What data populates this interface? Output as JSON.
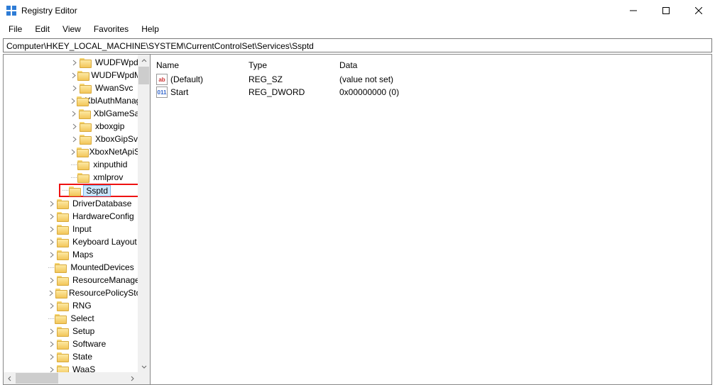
{
  "window": {
    "title": "Registry Editor"
  },
  "menu": {
    "file": "File",
    "edit": "Edit",
    "view": "View",
    "favorites": "Favorites",
    "help": "Help"
  },
  "address": "Computer\\HKEY_LOCAL_MACHINE\\SYSTEM\\CurrentControlSet\\Services\\Ssptd",
  "tree": {
    "deep": [
      {
        "label": "WUDFWpdFs",
        "expandable": true,
        "indent": 94
      },
      {
        "label": "WUDFWpdMtp",
        "expandable": true,
        "indent": 94
      },
      {
        "label": "WwanSvc",
        "expandable": true,
        "indent": 94
      },
      {
        "label": "XblAuthManager",
        "expandable": true,
        "indent": 94
      },
      {
        "label": "XblGameSave",
        "expandable": true,
        "indent": 94
      },
      {
        "label": "xboxgip",
        "expandable": true,
        "indent": 94
      },
      {
        "label": "XboxGipSvc",
        "expandable": true,
        "indent": 94
      },
      {
        "label": "XboxNetApiSvc",
        "expandable": true,
        "indent": 94
      },
      {
        "label": "xinputhid",
        "expandable": false,
        "indent": 94,
        "dots": true
      },
      {
        "label": "xmlprov",
        "expandable": false,
        "indent": 94,
        "dots": true
      }
    ],
    "selected": {
      "label": "Ssptd"
    },
    "mid": [
      {
        "label": "DriverDatabase",
        "expandable": true,
        "indent": 62
      },
      {
        "label": "HardwareConfig",
        "expandable": true,
        "indent": 62
      },
      {
        "label": "Input",
        "expandable": true,
        "indent": 62
      },
      {
        "label": "Keyboard Layout",
        "expandable": true,
        "indent": 62
      },
      {
        "label": "Maps",
        "expandable": true,
        "indent": 62
      },
      {
        "label": "MountedDevices",
        "expandable": false,
        "indent": 62,
        "dots": true
      },
      {
        "label": "ResourceManager",
        "expandable": true,
        "indent": 62
      },
      {
        "label": "ResourcePolicyStore",
        "expandable": true,
        "indent": 62
      },
      {
        "label": "RNG",
        "expandable": true,
        "indent": 62
      },
      {
        "label": "Select",
        "expandable": false,
        "indent": 62,
        "dots": true
      },
      {
        "label": "Setup",
        "expandable": true,
        "indent": 62
      },
      {
        "label": "Software",
        "expandable": true,
        "indent": 62
      },
      {
        "label": "State",
        "expandable": true,
        "indent": 62
      },
      {
        "label": "WaaS",
        "expandable": true,
        "indent": 62
      }
    ]
  },
  "list": {
    "headers": {
      "name": "Name",
      "type": "Type",
      "data": "Data"
    },
    "rows": [
      {
        "icon": "str",
        "glyph": "ab",
        "name": "(Default)",
        "type": "REG_SZ",
        "data": "(value not set)"
      },
      {
        "icon": "bin",
        "glyph": "011",
        "name": "Start",
        "type": "REG_DWORD",
        "data": "0x00000000 (0)"
      }
    ]
  }
}
